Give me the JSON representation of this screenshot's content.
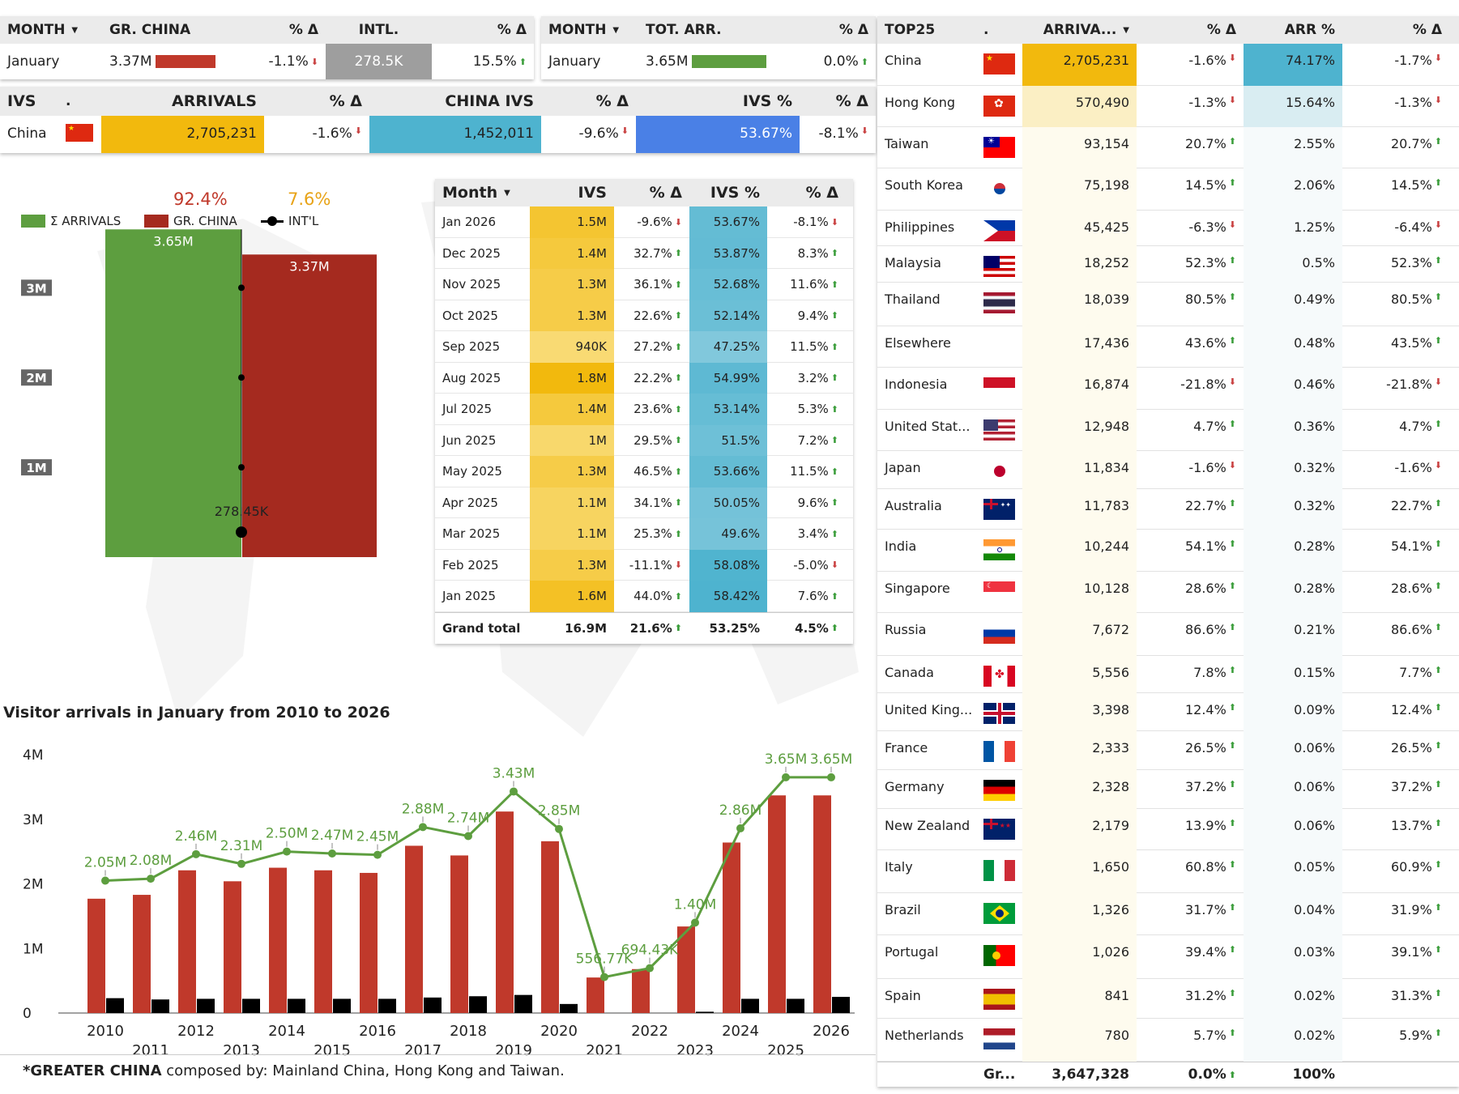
{
  "kpi_gr": {
    "h_month": "MONTH",
    "h_grchina": "GR. CHINA",
    "h_pd": "% Δ",
    "h_intl": "INTL.",
    "h_pd2": "% Δ",
    "month": "January",
    "grchina": "3.37M",
    "grchina_pct": "-1.1%",
    "intl": "278.5K",
    "intl_pct": "15.5%"
  },
  "kpi_tot": {
    "h_month": "MONTH",
    "h_tot": "TOT. ARR.",
    "h_pd": "% Δ",
    "month": "January",
    "tot": "3.65M",
    "tot_pct": "0.0%"
  },
  "ivs_bar": {
    "h_ivs": "IVS",
    "h_dot": ".",
    "h_arr": "ARRIVALS",
    "h_pd": "% Δ",
    "h_civs": "CHINA IVS",
    "h_pd2": "% Δ",
    "h_ivsp": "IVS %",
    "h_pd3": "% Δ",
    "country": "China",
    "arrivals": "2,705,231",
    "arr_pct": "-1.6%",
    "china_ivs": "1,452,011",
    "civs_pct": "-9.6%",
    "ivs_pct": "53.67%",
    "ivsp_pct": "-8.1%"
  },
  "bar_legend": {
    "arrivals": "Σ ARRIVALS",
    "grchina": "GR. CHINA",
    "intl": "INT'L",
    "grchina_share": "92.4%",
    "intl_share": "7.6%",
    "total_label": "3.65M",
    "grchina_label": "3.37M",
    "intl_label": "278.45K",
    "ticks": [
      "3M",
      "2M",
      "1M"
    ],
    "total_value": 3650000,
    "grchina_value": 3370000,
    "intl_value": 278450,
    "axis_max": 3950000
  },
  "monthly": {
    "headers": [
      "Month",
      "IVS",
      "% Δ",
      "IVS %",
      "% Δ"
    ],
    "rows": [
      {
        "m": "Jan 2026",
        "ivs": "1.5M",
        "ivs_v": 1.5,
        "p1": "-9.6%",
        "u1": false,
        "ip": "53.67%",
        "ip_v": 53.67,
        "p2": "-8.1%",
        "u2": false
      },
      {
        "m": "Dec 2025",
        "ivs": "1.4M",
        "ivs_v": 1.4,
        "p1": "32.7%",
        "u1": true,
        "ip": "53.87%",
        "ip_v": 53.87,
        "p2": "8.3%",
        "u2": true
      },
      {
        "m": "Nov 2025",
        "ivs": "1.3M",
        "ivs_v": 1.3,
        "p1": "36.1%",
        "u1": true,
        "ip": "52.68%",
        "ip_v": 52.68,
        "p2": "11.6%",
        "u2": true
      },
      {
        "m": "Oct 2025",
        "ivs": "1.3M",
        "ivs_v": 1.3,
        "p1": "22.6%",
        "u1": true,
        "ip": "52.14%",
        "ip_v": 52.14,
        "p2": "9.4%",
        "u2": true
      },
      {
        "m": "Sep 2025",
        "ivs": "940K",
        "ivs_v": 0.94,
        "p1": "27.2%",
        "u1": true,
        "ip": "47.25%",
        "ip_v": 47.25,
        "p2": "11.5%",
        "u2": true
      },
      {
        "m": "Aug 2025",
        "ivs": "1.8M",
        "ivs_v": 1.8,
        "p1": "22.2%",
        "u1": true,
        "ip": "54.99%",
        "ip_v": 54.99,
        "p2": "3.2%",
        "u2": true
      },
      {
        "m": "Jul 2025",
        "ivs": "1.4M",
        "ivs_v": 1.4,
        "p1": "23.6%",
        "u1": true,
        "ip": "53.14%",
        "ip_v": 53.14,
        "p2": "5.3%",
        "u2": true
      },
      {
        "m": "Jun 2025",
        "ivs": "1M",
        "ivs_v": 1.0,
        "p1": "29.5%",
        "u1": true,
        "ip": "51.5%",
        "ip_v": 51.5,
        "p2": "7.2%",
        "u2": true
      },
      {
        "m": "May 2025",
        "ivs": "1.3M",
        "ivs_v": 1.3,
        "p1": "46.5%",
        "u1": true,
        "ip": "53.66%",
        "ip_v": 53.66,
        "p2": "11.5%",
        "u2": true
      },
      {
        "m": "Apr 2025",
        "ivs": "1.1M",
        "ivs_v": 1.1,
        "p1": "34.1%",
        "u1": true,
        "ip": "50.05%",
        "ip_v": 50.05,
        "p2": "9.6%",
        "u2": true
      },
      {
        "m": "Mar 2025",
        "ivs": "1.1M",
        "ivs_v": 1.1,
        "p1": "25.3%",
        "u1": true,
        "ip": "49.6%",
        "ip_v": 49.6,
        "p2": "3.4%",
        "u2": true
      },
      {
        "m": "Feb 2025",
        "ivs": "1.3M",
        "ivs_v": 1.3,
        "p1": "-11.1%",
        "u1": false,
        "ip": "58.08%",
        "ip_v": 58.08,
        "p2": "-5.0%",
        "u2": false
      },
      {
        "m": "Jan 2025",
        "ivs": "1.6M",
        "ivs_v": 1.6,
        "p1": "44.0%",
        "u1": true,
        "ip": "58.42%",
        "ip_v": 58.42,
        "p2": "7.6%",
        "u2": true
      }
    ],
    "total": {
      "m": "Grand total",
      "ivs": "16.9M",
      "p1": "21.6%",
      "ip": "53.25%",
      "p2": "4.5%"
    }
  },
  "top25": {
    "headers": [
      "TOP25",
      ".",
      "ARRIVA...",
      "% Δ",
      "ARR %",
      "% Δ"
    ],
    "rows": [
      {
        "c": "China",
        "flag": "cn",
        "a": "2,705,231",
        "a_v": 2705231,
        "p1": "-1.6%",
        "u1": false,
        "s": "74.17%",
        "s_v": 74.17,
        "p2": "-1.7%",
        "u2": false
      },
      {
        "c": "Hong Kong",
        "flag": "hk",
        "a": "570,490",
        "a_v": 570490,
        "p1": "-1.3%",
        "u1": false,
        "s": "15.64%",
        "s_v": 15.64,
        "p2": "-1.3%",
        "u2": false
      },
      {
        "c": "Taiwan",
        "flag": "tw",
        "a": "93,154",
        "a_v": 93154,
        "p1": "20.7%",
        "u1": true,
        "s": "2.55%",
        "s_v": 2.55,
        "p2": "20.7%",
        "u2": true
      },
      {
        "c": "South Korea",
        "flag": "kr",
        "a": "75,198",
        "a_v": 75198,
        "p1": "14.5%",
        "u1": true,
        "s": "2.06%",
        "s_v": 2.06,
        "p2": "14.5%",
        "u2": true
      },
      {
        "c": "Philippines",
        "flag": "ph",
        "a": "45,425",
        "a_v": 45425,
        "p1": "-6.3%",
        "u1": false,
        "s": "1.25%",
        "s_v": 1.25,
        "p2": "-6.4%",
        "u2": false
      },
      {
        "c": "Malaysia",
        "flag": "my",
        "a": "18,252",
        "a_v": 18252,
        "p1": "52.3%",
        "u1": true,
        "s": "0.5%",
        "s_v": 0.5,
        "p2": "52.3%",
        "u2": true
      },
      {
        "c": "Thailand",
        "flag": "th",
        "a": "18,039",
        "a_v": 18039,
        "p1": "80.5%",
        "u1": true,
        "s": "0.49%",
        "s_v": 0.49,
        "p2": "80.5%",
        "u2": true
      },
      {
        "c": "Elsewhere",
        "flag": "",
        "a": "17,436",
        "a_v": 17436,
        "p1": "43.6%",
        "u1": true,
        "s": "0.48%",
        "s_v": 0.48,
        "p2": "43.5%",
        "u2": true
      },
      {
        "c": "Indonesia",
        "flag": "id",
        "a": "16,874",
        "a_v": 16874,
        "p1": "-21.8%",
        "u1": false,
        "s": "0.46%",
        "s_v": 0.46,
        "p2": "-21.8%",
        "u2": false
      },
      {
        "c": "United Stat...",
        "flag": "us",
        "a": "12,948",
        "a_v": 12948,
        "p1": "4.7%",
        "u1": true,
        "s": "0.36%",
        "s_v": 0.36,
        "p2": "4.7%",
        "u2": true
      },
      {
        "c": "Japan",
        "flag": "jp",
        "a": "11,834",
        "a_v": 11834,
        "p1": "-1.6%",
        "u1": false,
        "s": "0.32%",
        "s_v": 0.32,
        "p2": "-1.6%",
        "u2": false
      },
      {
        "c": "Australia",
        "flag": "au",
        "a": "11,783",
        "a_v": 11783,
        "p1": "22.7%",
        "u1": true,
        "s": "0.32%",
        "s_v": 0.32,
        "p2": "22.7%",
        "u2": true
      },
      {
        "c": "India",
        "flag": "in",
        "a": "10,244",
        "a_v": 10244,
        "p1": "54.1%",
        "u1": true,
        "s": "0.28%",
        "s_v": 0.28,
        "p2": "54.1%",
        "u2": true
      },
      {
        "c": "Singapore",
        "flag": "sg",
        "a": "10,128",
        "a_v": 10128,
        "p1": "28.6%",
        "u1": true,
        "s": "0.28%",
        "s_v": 0.28,
        "p2": "28.6%",
        "u2": true
      },
      {
        "c": "Russia",
        "flag": "ru",
        "a": "7,672",
        "a_v": 7672,
        "p1": "86.6%",
        "u1": true,
        "s": "0.21%",
        "s_v": 0.21,
        "p2": "86.6%",
        "u2": true
      },
      {
        "c": "Canada",
        "flag": "ca",
        "a": "5,556",
        "a_v": 5556,
        "p1": "7.8%",
        "u1": true,
        "s": "0.15%",
        "s_v": 0.15,
        "p2": "7.7%",
        "u2": true
      },
      {
        "c": "United King...",
        "flag": "gb",
        "a": "3,398",
        "a_v": 3398,
        "p1": "12.4%",
        "u1": true,
        "s": "0.09%",
        "s_v": 0.09,
        "p2": "12.4%",
        "u2": true
      },
      {
        "c": "France",
        "flag": "fr",
        "a": "2,333",
        "a_v": 2333,
        "p1": "26.5%",
        "u1": true,
        "s": "0.06%",
        "s_v": 0.06,
        "p2": "26.5%",
        "u2": true
      },
      {
        "c": "Germany",
        "flag": "de",
        "a": "2,328",
        "a_v": 2328,
        "p1": "37.2%",
        "u1": true,
        "s": "0.06%",
        "s_v": 0.06,
        "p2": "37.2%",
        "u2": true
      },
      {
        "c": "New Zealand",
        "flag": "nz",
        "a": "2,179",
        "a_v": 2179,
        "p1": "13.9%",
        "u1": true,
        "s": "0.06%",
        "s_v": 0.06,
        "p2": "13.7%",
        "u2": true
      },
      {
        "c": "Italy",
        "flag": "it",
        "a": "1,650",
        "a_v": 1650,
        "p1": "60.8%",
        "u1": true,
        "s": "0.05%",
        "s_v": 0.05,
        "p2": "60.9%",
        "u2": true
      },
      {
        "c": "Brazil",
        "flag": "br",
        "a": "1,326",
        "a_v": 1326,
        "p1": "31.7%",
        "u1": true,
        "s": "0.04%",
        "s_v": 0.04,
        "p2": "31.9%",
        "u2": true
      },
      {
        "c": "Portugal",
        "flag": "pt",
        "a": "1,026",
        "a_v": 1026,
        "p1": "39.4%",
        "u1": true,
        "s": "0.03%",
        "s_v": 0.03,
        "p2": "39.1%",
        "u2": true
      },
      {
        "c": "Spain",
        "flag": "es",
        "a": "841",
        "a_v": 841,
        "p1": "31.2%",
        "u1": true,
        "s": "0.02%",
        "s_v": 0.02,
        "p2": "31.3%",
        "u2": true
      },
      {
        "c": "Netherlands",
        "flag": "nl",
        "a": "780",
        "a_v": 780,
        "p1": "5.7%",
        "u1": true,
        "s": "0.02%",
        "s_v": 0.02,
        "p2": "5.9%",
        "u2": true
      }
    ],
    "total": {
      "c": "Gr...",
      "a": "3,647,328",
      "p1": "0.0%",
      "s": "100%"
    }
  },
  "footnote": {
    "bold": "*GREATER CHINA",
    "rest": " composed by: Mainland China, Hong Kong and Taiwan."
  },
  "colors": {
    "green": "#5d9e3f",
    "red": "#c0392b",
    "darkred": "#a52a1f",
    "gold": "#f2b90d",
    "teal": "#4eb3cf",
    "blue": "#4a80e6",
    "gray": "#9e9e9e"
  },
  "chart_data": {
    "type": "bar",
    "title": "Visitor arrivals in January from 2010 to 2026",
    "categories": [
      "2010",
      "2011",
      "2012",
      "2013",
      "2014",
      "2015",
      "2016",
      "2017",
      "2018",
      "2019",
      "2020",
      "2021",
      "2022",
      "2023",
      "2024",
      "2025",
      "2026"
    ],
    "series": [
      {
        "values": [
          1.77,
          1.83,
          2.21,
          2.04,
          2.25,
          2.21,
          2.17,
          2.59,
          2.44,
          3.12,
          2.66,
          0.55,
          0.68,
          1.34,
          2.64,
          3.37,
          3.37
        ]
      },
      {
        "values": [
          0.23,
          0.21,
          0.22,
          0.22,
          0.22,
          0.22,
          0.22,
          0.24,
          0.26,
          0.28,
          0.14,
          0.0,
          0.0,
          0.02,
          0.22,
          0.22,
          0.25
        ]
      },
      {
        "type": "line",
        "values": [
          2.05,
          2.08,
          2.46,
          2.31,
          2.5,
          2.47,
          2.45,
          2.88,
          2.74,
          3.43,
          2.85,
          0.55677,
          0.69443,
          1.4,
          2.86,
          3.65,
          3.65
        ],
        "labels": [
          "2.05M",
          "2.08M",
          "2.46M",
          "2.31M",
          "2.50M",
          "2.47M",
          "2.45M",
          "2.88M",
          "2.74M",
          "3.43M",
          "2.85M",
          "556.77K",
          "694.43K",
          "1.40M",
          "2.86M",
          "3.65M",
          "3.65M"
        ]
      }
    ],
    "ylim": [
      0,
      4
    ],
    "yticks": [
      "4M",
      "3M",
      "2M",
      "1M",
      "0"
    ],
    "grid": false
  }
}
